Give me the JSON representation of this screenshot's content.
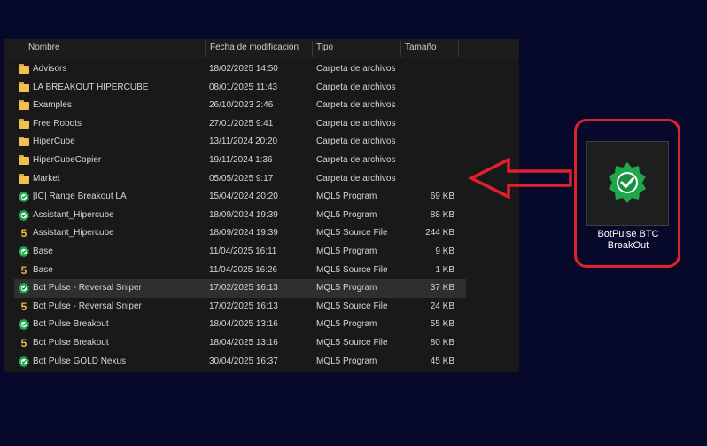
{
  "explorer": {
    "columns": {
      "name": "Nombre",
      "date": "Fecha de modificación",
      "type": "Tipo",
      "size": "Tamaño"
    },
    "rows": [
      {
        "icon": "folder-icon",
        "name": "Advisors",
        "date": "18/02/2025 14:50",
        "type": "Carpeta de archivos",
        "size": ""
      },
      {
        "icon": "folder-icon",
        "name": "LA BREAKOUT HIPERCUBE",
        "date": "08/01/2025 11:43",
        "type": "Carpeta de archivos",
        "size": ""
      },
      {
        "icon": "folder-icon",
        "name": "Examples",
        "date": "26/10/2023 2:46",
        "type": "Carpeta de archivos",
        "size": ""
      },
      {
        "icon": "folder-icon",
        "name": "Free Robots",
        "date": "27/01/2025 9:41",
        "type": "Carpeta de archivos",
        "size": ""
      },
      {
        "icon": "folder-icon",
        "name": "HiperCube",
        "date": "13/11/2024 20:20",
        "type": "Carpeta de archivos",
        "size": ""
      },
      {
        "icon": "folder-icon",
        "name": "HiperCubeCopier",
        "date": "19/11/2024 1:36",
        "type": "Carpeta de archivos",
        "size": ""
      },
      {
        "icon": "folder-icon",
        "name": "Market",
        "date": "05/05/2025 9:17",
        "type": "Carpeta de archivos",
        "size": ""
      },
      {
        "icon": "gear-icon",
        "name": "[IC] Range Breakout LA",
        "date": "15/04/2024 20:20",
        "type": "MQL5 Program",
        "size": "69 KB"
      },
      {
        "icon": "gear-icon",
        "name": "Assistant_Hipercube",
        "date": "18/09/2024 19:39",
        "type": "MQL5 Program",
        "size": "88 KB"
      },
      {
        "icon": "five-icon",
        "name": "Assistant_Hipercube",
        "date": "18/09/2024 19:39",
        "type": "MQL5 Source File",
        "size": "244 KB"
      },
      {
        "icon": "gear-icon",
        "name": "Base",
        "date": "11/04/2025 16:11",
        "type": "MQL5 Program",
        "size": "9 KB"
      },
      {
        "icon": "five-icon",
        "name": "Base",
        "date": "11/04/2025 16:26",
        "type": "MQL5 Source File",
        "size": "1 KB"
      },
      {
        "icon": "gear-icon",
        "name": "Bot Pulse - Reversal Sniper",
        "date": "17/02/2025 16:13",
        "type": "MQL5 Program",
        "size": "37 KB",
        "selected": true
      },
      {
        "icon": "five-icon",
        "name": "Bot Pulse - Reversal Sniper",
        "date": "17/02/2025 16:13",
        "type": "MQL5 Source File",
        "size": "24 KB"
      },
      {
        "icon": "gear-icon",
        "name": "Bot Pulse Breakout",
        "date": "18/04/2025 13:16",
        "type": "MQL5 Program",
        "size": "55 KB"
      },
      {
        "icon": "five-icon",
        "name": "Bot Pulse Breakout",
        "date": "18/04/2025 13:16",
        "type": "MQL5 Source File",
        "size": "80 KB"
      },
      {
        "icon": "gear-icon",
        "name": "Bot Pulse GOLD Nexus",
        "date": "30/04/2025 16:37",
        "type": "MQL5 Program",
        "size": "45 KB"
      }
    ]
  },
  "highlight": {
    "file_label": "BotPulse BTC BreakOut",
    "icon": "gear-check-icon",
    "accent_color": "#e0202a",
    "icon_color": "#1fa84a"
  }
}
